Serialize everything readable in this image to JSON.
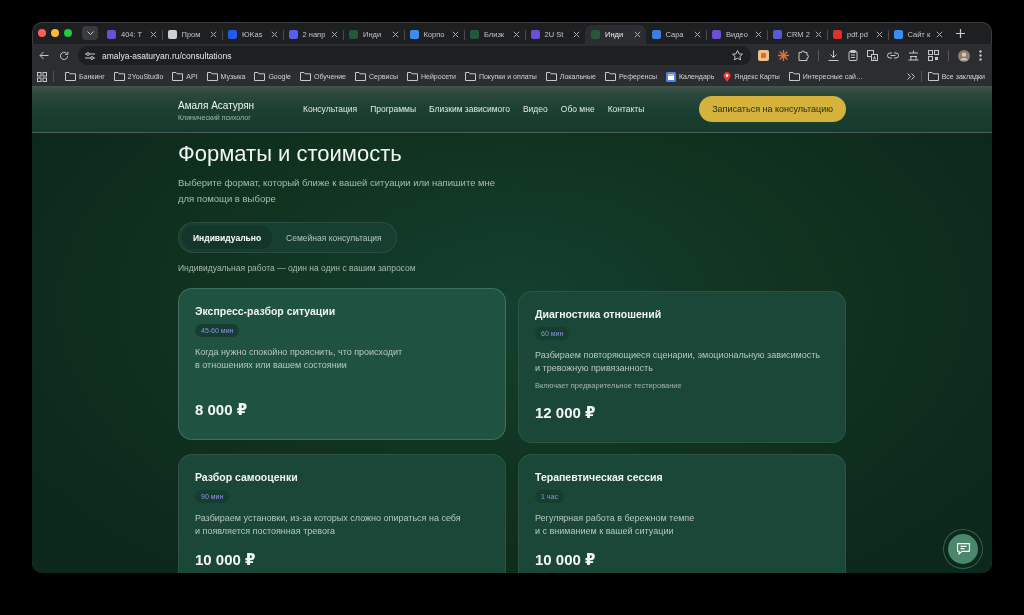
{
  "browser": {
    "tabs": [
      {
        "title": "404: T",
        "color": "#6b4fd6",
        "selected": false
      },
      {
        "title": "Пром",
        "color": "#cfd2d4",
        "selected": false
      },
      {
        "title": "ЮKas",
        "color": "#1f5cf0",
        "selected": false
      },
      {
        "title": "2 напр",
        "color": "#5b5cf2",
        "selected": false
      },
      {
        "title": "Инди",
        "color": "#24573d",
        "selected": false
      },
      {
        "title": "Корпо",
        "color": "#3b8ef0",
        "selected": false
      },
      {
        "title": "Близк",
        "color": "#24573d",
        "selected": false
      },
      {
        "title": "2U St",
        "color": "#6b4fd6",
        "selected": false
      },
      {
        "title": "Инди",
        "color": "#24573d",
        "selected": true
      },
      {
        "title": "Сара",
        "color": "#3d7ee2",
        "selected": false
      },
      {
        "title": "Видео",
        "color": "#6b4fd6",
        "selected": false
      },
      {
        "title": "CRM 2",
        "color": "#5a5ad6",
        "selected": false
      },
      {
        "title": "pdf.pd",
        "color": "#e0302a",
        "selected": false
      },
      {
        "title": "Сайт к",
        "color": "#3b8ef0",
        "selected": false
      }
    ],
    "address": "amalya-asaturyan.ru/consultations",
    "bookmarks": [
      {
        "label": "Банкинг",
        "kind": "folder"
      },
      {
        "label": "2YouStudio",
        "kind": "folder"
      },
      {
        "label": "API",
        "kind": "folder"
      },
      {
        "label": "Музыка",
        "kind": "folder"
      },
      {
        "label": "Google",
        "kind": "folder"
      },
      {
        "label": "Обучение",
        "kind": "folder"
      },
      {
        "label": "Сервисы",
        "kind": "folder"
      },
      {
        "label": "Нейросети",
        "kind": "folder"
      },
      {
        "label": "Покупки и оплаты",
        "kind": "folder"
      },
      {
        "label": "Локальные",
        "kind": "folder"
      },
      {
        "label": "Референсы",
        "kind": "folder"
      },
      {
        "label": "Календарь",
        "kind": "calendar"
      },
      {
        "label": "Яндекс Карты",
        "kind": "pin"
      },
      {
        "label": "Интересные сай…",
        "kind": "folder"
      }
    ],
    "all_bookmarks": "Все закладки"
  },
  "site_header": {
    "name": "Амаля Асатурян",
    "subtitle": "Клинический психолог",
    "nav": [
      "Консультация",
      "Программы",
      "Близким зависимого",
      "Видео",
      "Обо мне",
      "Контакты"
    ],
    "cta": "Записаться на консультацию"
  },
  "section": {
    "title": "Форматы и стоимость",
    "subtitle": "Выберите формат, который ближе к вашей ситуации или напишите мне\nдля помощи в выборе",
    "tabs": [
      {
        "label": "Индивидуально",
        "selected": true
      },
      {
        "label": "Семейная консультация",
        "selected": false
      }
    ],
    "note": "Индивидуальная работа — один на один с вашим запросом",
    "cards": [
      {
        "title": "Экспресс-разбор ситуации",
        "duration": "45-60 мин",
        "description": "Когда нужно спокойно прояснить, что происходит\nв отношениях или вашем состоянии",
        "price": "8 000 ₽",
        "hovered": true
      },
      {
        "title": "Диагностика отношений",
        "duration": "60 мин",
        "description": "Разбираем повторяющиеся сценарии, эмоциональную зависимость\nи тревожную привязанность",
        "note": "Включает предварительное тестирование",
        "price": "12 000 ₽",
        "hovered": false
      },
      {
        "title": "Разбор самооценки",
        "duration": "90 мин",
        "description": "Разбираем установки, из-за которых сложно опираться на себя\nи появляется постоянная тревога",
        "price": "10 000 ₽",
        "hovered": false
      },
      {
        "title": "Терапевтическая сессия",
        "duration": "1 час",
        "description": "Регулярная работа в бережном темпе\nи с вниманием к вашей ситуации",
        "price": "10 000 ₽",
        "hovered": false
      }
    ]
  }
}
